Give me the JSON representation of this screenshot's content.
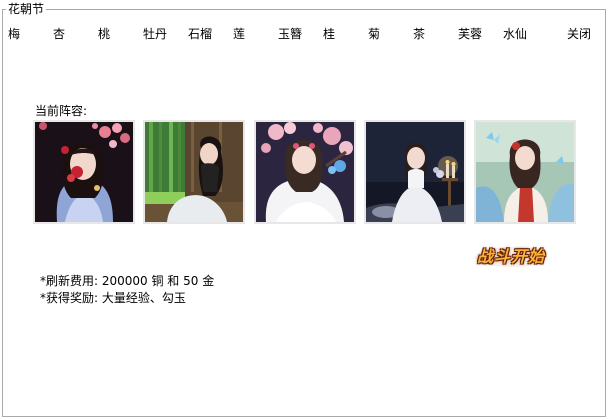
{
  "window": {
    "title": "花朝节"
  },
  "tabs": [
    {
      "label": "梅"
    },
    {
      "label": "杏"
    },
    {
      "label": "桃"
    },
    {
      "label": "牡丹"
    },
    {
      "label": "石榴"
    },
    {
      "label": "莲"
    },
    {
      "label": "玉簪"
    },
    {
      "label": "桂"
    },
    {
      "label": "菊"
    },
    {
      "label": "茶"
    },
    {
      "label": "芙蓉"
    },
    {
      "label": "水仙"
    }
  ],
  "close_label": "关闭",
  "lineup": {
    "label": "当前阵容:",
    "cards": [
      {
        "icon": "character-portrait-red-flowers-icon"
      },
      {
        "icon": "character-portrait-bamboo-porch-icon"
      },
      {
        "icon": "character-portrait-cherry-blossom-night-icon"
      },
      {
        "icon": "character-portrait-candlelight-icon"
      },
      {
        "icon": "character-portrait-butterfly-garden-icon"
      }
    ]
  },
  "start_button": {
    "label": "战斗开始"
  },
  "info": {
    "refresh_cost": "*刷新费用: 200000 铜 和 50 金",
    "reward": "*获得奖励: 大量经验、勾玉"
  },
  "colors": {
    "frame_border": "#a9a9a9",
    "card_border": "#e7e7e7",
    "start_text": "#f7b43a"
  }
}
